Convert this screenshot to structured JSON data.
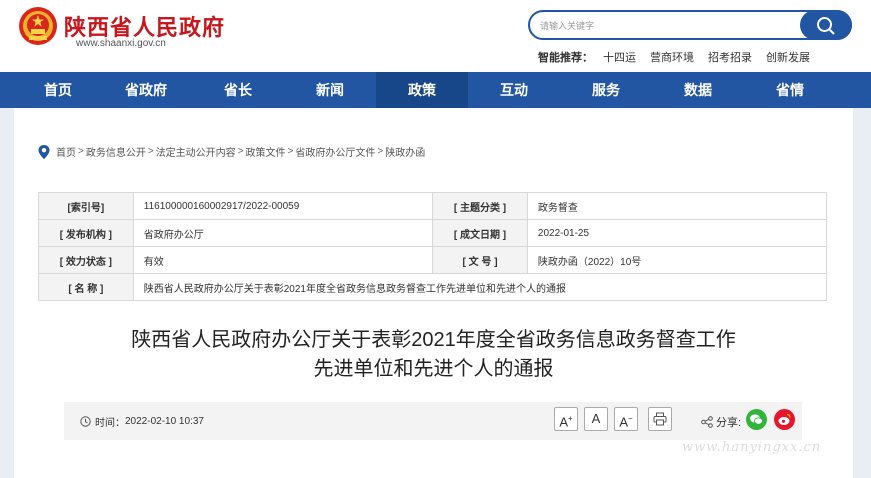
{
  "header": {
    "site_title": "陕西省人民政府",
    "site_url": "www.shaanxi.gov.cn",
    "search_placeholder": "请输入关键字",
    "hot_label": "智能推荐：",
    "hot_items": [
      "十四运",
      "营商环境",
      "招考招录",
      "创新发展"
    ]
  },
  "nav": {
    "items": [
      "首页",
      "省政府",
      "省长",
      "新闻",
      "政策",
      "互动",
      "服务",
      "数据",
      "省情"
    ],
    "active": "政策"
  },
  "breadcrumb": [
    "首页",
    "政务信息公开",
    "法定主动公开内容",
    "政策文件",
    "省政府办公厅文件",
    "陕政办函"
  ],
  "meta": {
    "index_label": "[索引号]",
    "index_value": "116100000160002917/2022-00059",
    "topic_label": "[ 主题分类 ]",
    "topic_value": "政务督查",
    "issuer_label": "[ 发布机构 ]",
    "issuer_value": "省政府办公厅",
    "date_label": "[ 成文日期 ]",
    "date_value": "2022-01-25",
    "status_label": "[ 效力状态 ]",
    "status_value": "有效",
    "docno_label": "[ 文  号 ]",
    "docno_value": "陕政办函（2022）10号",
    "name_label": "[ 名  称 ]",
    "name_value": "陕西省人民政府办公厅关于表彰2021年度全省政务信息政务督查工作先进单位和先进个人的通报"
  },
  "document": {
    "title_line1": "陕西省人民政府办公厅关于表彰2021年度全省政务信息政务督查工作",
    "title_line2": "先进单位和先进个人的通报",
    "time_label": "时间：",
    "time_value": "2022-02-10 10:37",
    "font_larger": "A",
    "font_normal": "A",
    "font_smaller": "A",
    "share_label": "分享:"
  },
  "watermark": "www.hanyingxx.cn",
  "colors": {
    "brand_red": "#c8161d",
    "nav_blue": "#2256a3",
    "wechat_green": "#32b53c",
    "weibo_red": "#e6162d"
  }
}
